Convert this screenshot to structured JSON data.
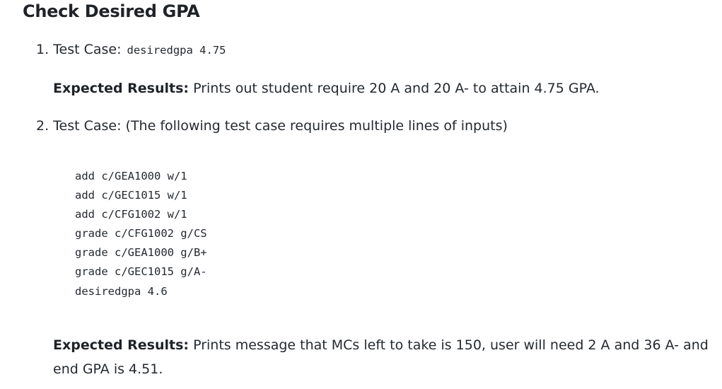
{
  "heading": "Check Desired GPA",
  "items": [
    {
      "number": "1.",
      "label": "Test Case:",
      "inline_code": "desiredgpa 4.75",
      "expected_label": "Expected Results:",
      "expected_text": "Prints out student require 20 A and 20 A- to attain 4.75 GPA."
    },
    {
      "number": "2.",
      "label": "Test Case: (The following test case requires multiple lines of inputs)",
      "code_lines": [
        "add c/GEA1000 w/1",
        "add c/GEC1015 w/1",
        "add c/CFG1002 w/1",
        "grade c/CFG1002 g/CS",
        "grade c/GEA1000 g/B+",
        "grade c/GEC1015 g/A-",
        "desiredgpa 4.6"
      ],
      "expected_label": "Expected Results:",
      "expected_text": "Prints message that MCs left to take is 150, user will need 2 A and 36 A- and end GPA is 4.51."
    }
  ]
}
